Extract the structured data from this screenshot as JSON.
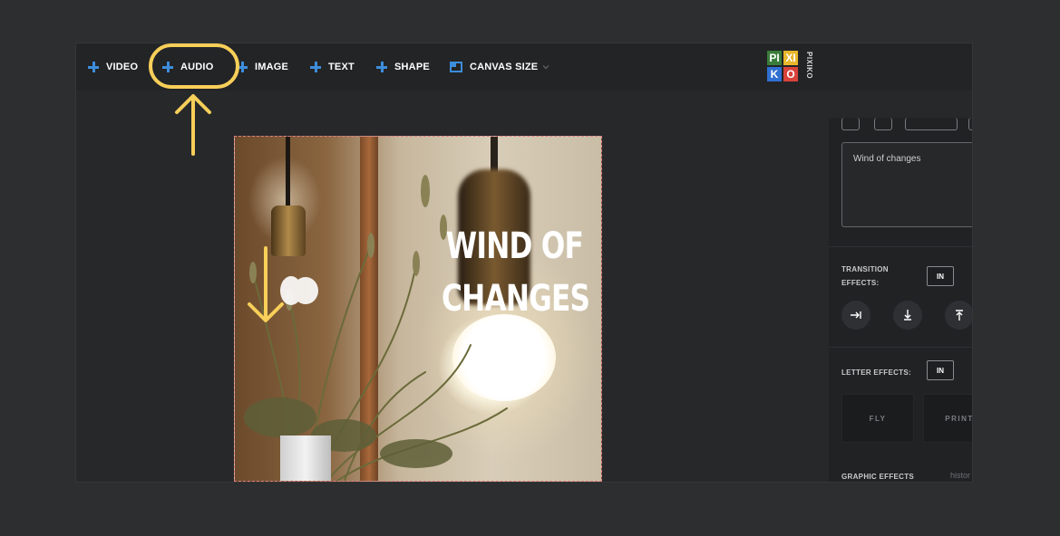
{
  "toolbar": {
    "video_label": "VIDEO",
    "audio_label": "AUDIO",
    "image_label": "IMAGE",
    "text_label": "TEXT",
    "shape_label": "SHAPE",
    "canvas_size_label": "CANVAS SIZE"
  },
  "logo": {
    "tiles": [
      "PI",
      "XI",
      "K",
      "O"
    ],
    "vertical_text": "PIXIKO",
    "colors": [
      "#3a7d3a",
      "#e8b62a",
      "#2f6fd1",
      "#d9423a"
    ]
  },
  "canvas": {
    "title": "WIND OF CHANGES"
  },
  "panel": {
    "text_value": "Wind of changes",
    "transition_label": "TRANSITION EFFECTS:",
    "transition_in": "IN",
    "letter_label": "LETTER EFFECTS:",
    "letter_in": "IN",
    "effects": [
      "FLY",
      "PRINT"
    ],
    "graphic_label": "GRAPHIC EFFECTS",
    "history_label": "histor"
  },
  "colors": {
    "accent_blue": "#3d8ddb",
    "highlight_yellow": "#f7cf59"
  }
}
